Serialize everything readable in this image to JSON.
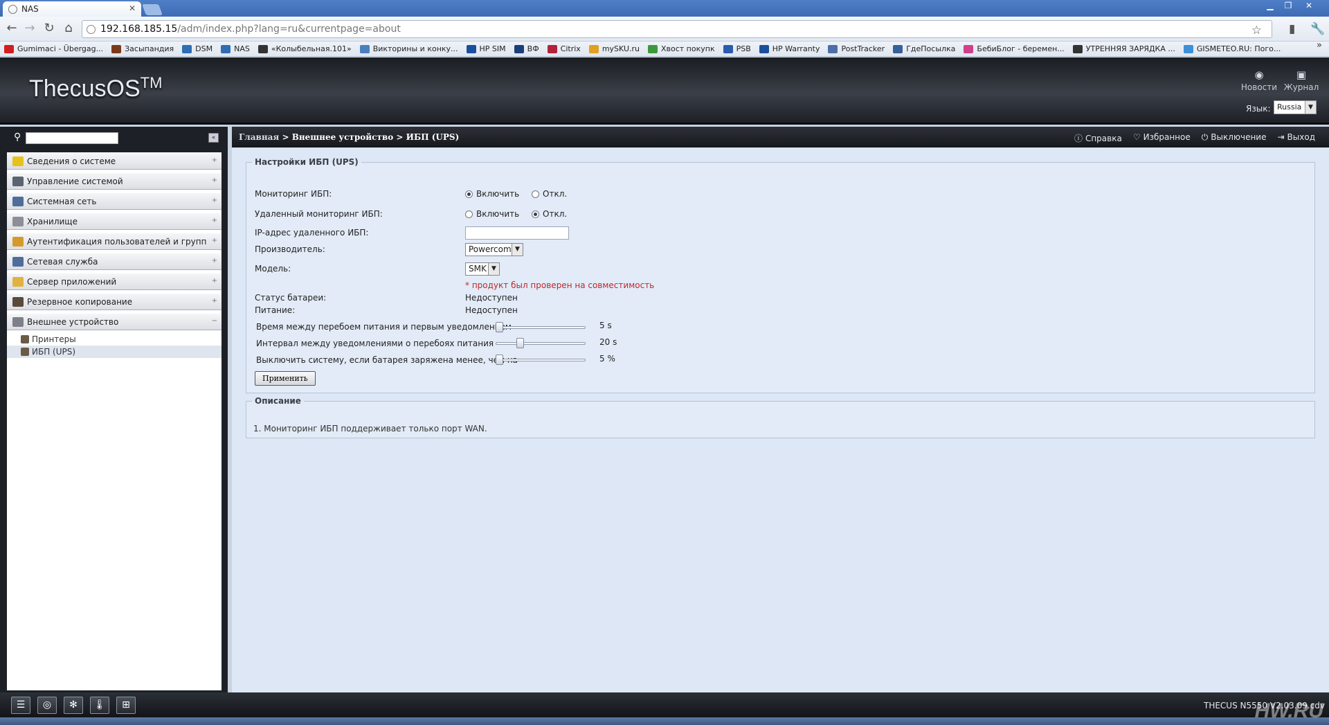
{
  "browser": {
    "tab_title": "NAS",
    "url_main": "192.168.185.15",
    "url_rest": "/adm/index.php?lang=ru&currentpage=about",
    "bookmarks": [
      {
        "label": "Gumimaci - Übergag...",
        "color": "#d21e1e"
      },
      {
        "label": "Засыпандия",
        "color": "#7a3a1a"
      },
      {
        "label": "DSM",
        "color": "#2f6db5"
      },
      {
        "label": "NAS",
        "color": "#2f6db5"
      },
      {
        "label": "«Колыбельная.101»",
        "color": "#333333"
      },
      {
        "label": "Викторины и конку...",
        "color": "#4a7fbf"
      },
      {
        "label": "HP SIM",
        "color": "#1a4f9c"
      },
      {
        "label": "ВФ",
        "color": "#1b3f7a"
      },
      {
        "label": "Citrix",
        "color": "#b3223a"
      },
      {
        "label": "mySKU.ru",
        "color": "#e0a020"
      },
      {
        "label": "Хвост покупк",
        "color": "#3a9a3a"
      },
      {
        "label": "PSB",
        "color": "#2b5cae"
      },
      {
        "label": "HP Warranty",
        "color": "#1a4f9c"
      },
      {
        "label": "PostTracker",
        "color": "#4c6fa8"
      },
      {
        "label": "ГдеПосылка",
        "color": "#35609a"
      },
      {
        "label": "БебиБлог - беремен...",
        "color": "#d0408a"
      },
      {
        "label": "УТРЕННЯЯ ЗАРЯДКА ...",
        "color": "#333333"
      },
      {
        "label": "GISMETEO.RU: Пого...",
        "color": "#3d8fd8"
      }
    ]
  },
  "header": {
    "logo": "ThecusOS",
    "logo_tm": "TM",
    "news": "Новости",
    "journal": "Журнал",
    "lang_label": "Язык:",
    "lang_value": "Russia"
  },
  "sidebar": {
    "menu": [
      {
        "label": "Сведения о системе",
        "color": "#e8c21c"
      },
      {
        "label": "Управление системой",
        "color": "#5b6470"
      },
      {
        "label": "Системная сеть",
        "color": "#4f6d9a"
      },
      {
        "label": "Хранилище",
        "color": "#8c8f95"
      },
      {
        "label": "Аутентификация пользователей и групп",
        "color": "#d59a2a"
      },
      {
        "label": "Сетевая служба",
        "color": "#4f6d9a"
      },
      {
        "label": "Сервер приложений",
        "color": "#e0b340"
      },
      {
        "label": "Резервное копирование",
        "color": "#5a4a3a"
      },
      {
        "label": "Внешнее устройство",
        "color": "#7d8088",
        "expanded": true
      }
    ],
    "submenu": [
      {
        "label": "Принтеры"
      },
      {
        "label": "ИБП (UPS)",
        "active": true
      }
    ]
  },
  "breadcrumb": {
    "home": "Главная",
    "sep1": " > ",
    "level1": "Внешнее устройство",
    "sep2": " > ",
    "level2": "ИБП (UPS)"
  },
  "topactions": {
    "help": "Справка",
    "favorites": "Избранное",
    "shutdown": "Выключение",
    "logout": "Выход"
  },
  "ups": {
    "legend": "Настройки ИБП (UPS)",
    "monitoring_label": "Мониторинг ИБП:",
    "remote_label": "Удаленный мониторинг ИБП:",
    "enable": "Включить",
    "disable": "Откл.",
    "monitoring_enabled": true,
    "remote_enabled": false,
    "ip_label": "IP-адрес удаленного ИБП:",
    "ip_value": "",
    "vendor_label": "Производитель:",
    "vendor_value": "Powercom",
    "model_label": "Модель:",
    "model_value": "SMK",
    "compat_note": "* продукт был проверен на совместимость",
    "battery_label": "Статус батареи:",
    "battery_value": "Недоступен",
    "power_label": "Питание:",
    "power_value": "Недоступен",
    "slider1_label": "Время между перебоем питания и первым уведомлением",
    "slider1_value": "5 s",
    "slider1_fraction": 0.0,
    "slider2_label": "Интервал между уведомлениями о перебоях питания",
    "slider2_value": "20 s",
    "slider2_fraction": 0.25,
    "slider3_label": "Выключить систему, если батарея заряжена менее, чем на",
    "slider3_value": "5 %",
    "slider3_fraction": 0.0,
    "apply": "Применить"
  },
  "description": {
    "legend": "Описание",
    "text": "1. Мониторинг ИБП поддерживает только порт WAN."
  },
  "footer": {
    "model": "THECUS N5550 V2.03.09.cdv",
    "watermark": "HW.RU"
  }
}
